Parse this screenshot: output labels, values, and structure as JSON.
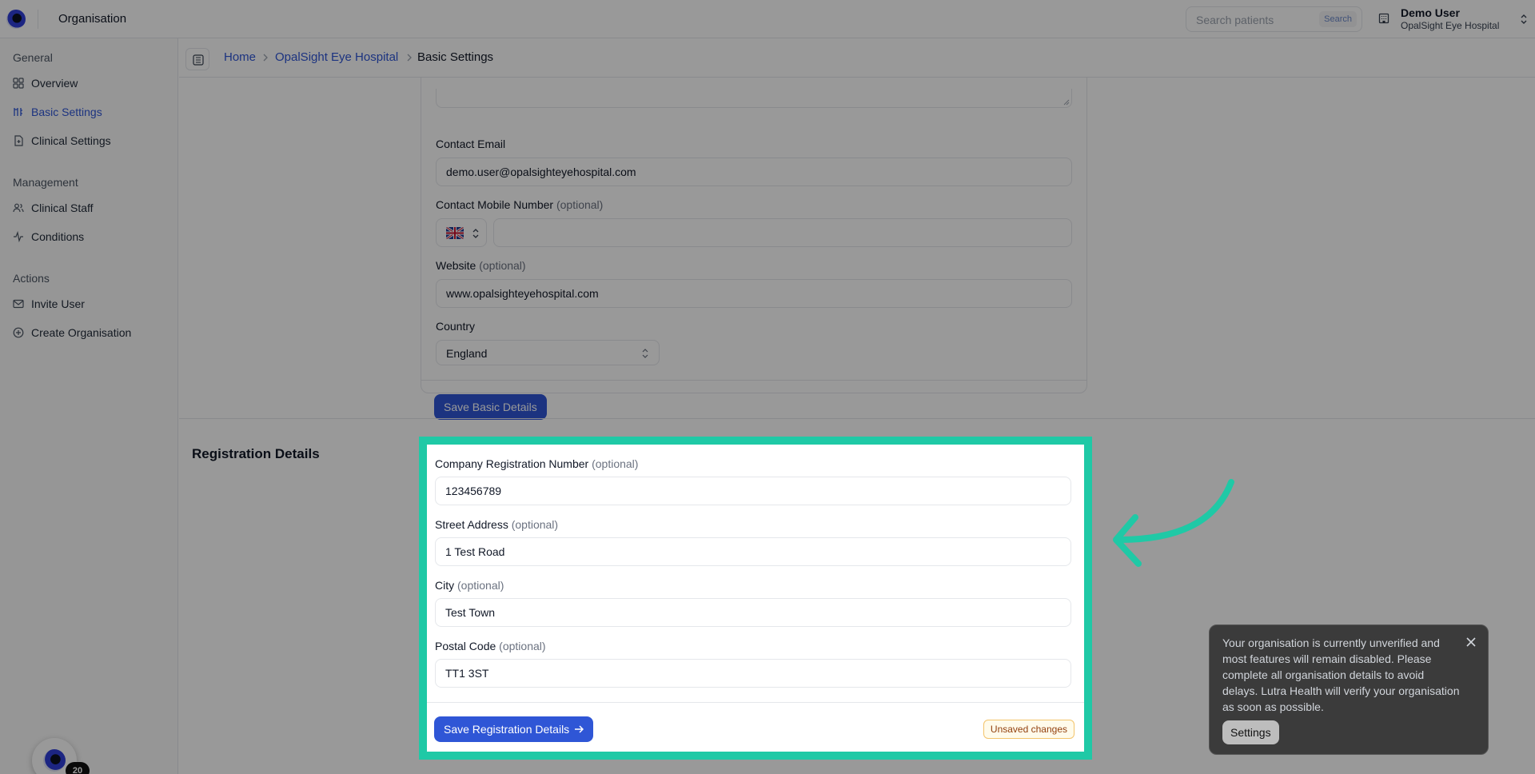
{
  "header": {
    "title": "Organisation",
    "search": {
      "placeholder": "Search patients",
      "button": "Search"
    },
    "user": {
      "name": "Demo User",
      "org": "OpalSight Eye Hospital"
    }
  },
  "sidebar": {
    "groups": [
      {
        "title": "General",
        "items": [
          {
            "label": "Overview",
            "icon": "grid-icon"
          },
          {
            "label": "Basic Settings",
            "icon": "sliders-icon",
            "active": true
          },
          {
            "label": "Clinical Settings",
            "icon": "file-plus-icon"
          }
        ]
      },
      {
        "title": "Management",
        "items": [
          {
            "label": "Clinical Staff",
            "icon": "users-icon"
          },
          {
            "label": "Conditions",
            "icon": "activity-icon"
          }
        ]
      },
      {
        "title": "Actions",
        "items": [
          {
            "label": "Invite User",
            "icon": "mail-icon"
          },
          {
            "label": "Create Organisation",
            "icon": "plus-circle-icon"
          }
        ]
      }
    ],
    "badge_count": "20"
  },
  "breadcrumb": {
    "home": "Home",
    "org": "OpalSight Eye Hospital",
    "current": "Basic Settings"
  },
  "basic_details": {
    "contact_email": {
      "label": "Contact Email",
      "value": "demo.user@opalsighteyehospital.com"
    },
    "contact_mobile": {
      "label": "Contact Mobile Number",
      "optional": "(optional)",
      "value": ""
    },
    "website": {
      "label": "Website",
      "optional": "(optional)",
      "value": "www.opalsighteyehospital.com"
    },
    "country": {
      "label": "Country",
      "value": "England"
    },
    "save_label": "Save Basic Details"
  },
  "registration": {
    "section_title": "Registration Details",
    "company_reg": {
      "label": "Company Registration Number",
      "optional": "(optional)",
      "value": "123456789"
    },
    "street": {
      "label": "Street Address",
      "optional": "(optional)",
      "value": "1 Test Road"
    },
    "city": {
      "label": "City",
      "optional": "(optional)",
      "value": "Test Town"
    },
    "postal": {
      "label": "Postal Code",
      "optional": "(optional)",
      "value": "TT1 3ST"
    },
    "save_label": "Save Registration Details",
    "unsaved_label": "Unsaved changes"
  },
  "toast": {
    "message": "Your organisation is currently unverified and most features will remain disabled. Please complete all organisation details to avoid delays. Lutra Health will verify your organisation as soon as possible.",
    "button": "Settings"
  },
  "colors": {
    "accent": "#2f56d6",
    "highlight": "#1fc9a6",
    "toast_bg": "#3b3b3b"
  }
}
